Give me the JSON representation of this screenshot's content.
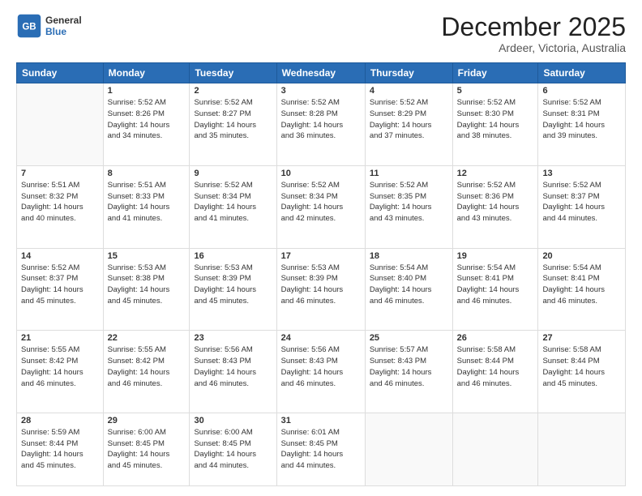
{
  "logo": {
    "general": "General",
    "blue": "Blue"
  },
  "header": {
    "month": "December 2025",
    "location": "Ardeer, Victoria, Australia"
  },
  "weekdays": [
    "Sunday",
    "Monday",
    "Tuesday",
    "Wednesday",
    "Thursday",
    "Friday",
    "Saturday"
  ],
  "weeks": [
    [
      {
        "day": "",
        "sunrise": "",
        "sunset": "",
        "daylight": ""
      },
      {
        "day": "1",
        "sunrise": "Sunrise: 5:52 AM",
        "sunset": "Sunset: 8:26 PM",
        "daylight": "Daylight: 14 hours",
        "minutes": "and 34 minutes."
      },
      {
        "day": "2",
        "sunrise": "Sunrise: 5:52 AM",
        "sunset": "Sunset: 8:27 PM",
        "daylight": "Daylight: 14 hours",
        "minutes": "and 35 minutes."
      },
      {
        "day": "3",
        "sunrise": "Sunrise: 5:52 AM",
        "sunset": "Sunset: 8:28 PM",
        "daylight": "Daylight: 14 hours",
        "minutes": "and 36 minutes."
      },
      {
        "day": "4",
        "sunrise": "Sunrise: 5:52 AM",
        "sunset": "Sunset: 8:29 PM",
        "daylight": "Daylight: 14 hours",
        "minutes": "and 37 minutes."
      },
      {
        "day": "5",
        "sunrise": "Sunrise: 5:52 AM",
        "sunset": "Sunset: 8:30 PM",
        "daylight": "Daylight: 14 hours",
        "minutes": "and 38 minutes."
      },
      {
        "day": "6",
        "sunrise": "Sunrise: 5:52 AM",
        "sunset": "Sunset: 8:31 PM",
        "daylight": "Daylight: 14 hours",
        "minutes": "and 39 minutes."
      }
    ],
    [
      {
        "day": "7",
        "sunrise": "Sunrise: 5:51 AM",
        "sunset": "Sunset: 8:32 PM",
        "daylight": "Daylight: 14 hours",
        "minutes": "and 40 minutes."
      },
      {
        "day": "8",
        "sunrise": "Sunrise: 5:51 AM",
        "sunset": "Sunset: 8:33 PM",
        "daylight": "Daylight: 14 hours",
        "minutes": "and 41 minutes."
      },
      {
        "day": "9",
        "sunrise": "Sunrise: 5:52 AM",
        "sunset": "Sunset: 8:34 PM",
        "daylight": "Daylight: 14 hours",
        "minutes": "and 41 minutes."
      },
      {
        "day": "10",
        "sunrise": "Sunrise: 5:52 AM",
        "sunset": "Sunset: 8:34 PM",
        "daylight": "Daylight: 14 hours",
        "minutes": "and 42 minutes."
      },
      {
        "day": "11",
        "sunrise": "Sunrise: 5:52 AM",
        "sunset": "Sunset: 8:35 PM",
        "daylight": "Daylight: 14 hours",
        "minutes": "and 43 minutes."
      },
      {
        "day": "12",
        "sunrise": "Sunrise: 5:52 AM",
        "sunset": "Sunset: 8:36 PM",
        "daylight": "Daylight: 14 hours",
        "minutes": "and 43 minutes."
      },
      {
        "day": "13",
        "sunrise": "Sunrise: 5:52 AM",
        "sunset": "Sunset: 8:37 PM",
        "daylight": "Daylight: 14 hours",
        "minutes": "and 44 minutes."
      }
    ],
    [
      {
        "day": "14",
        "sunrise": "Sunrise: 5:52 AM",
        "sunset": "Sunset: 8:37 PM",
        "daylight": "Daylight: 14 hours",
        "minutes": "and 45 minutes."
      },
      {
        "day": "15",
        "sunrise": "Sunrise: 5:53 AM",
        "sunset": "Sunset: 8:38 PM",
        "daylight": "Daylight: 14 hours",
        "minutes": "and 45 minutes."
      },
      {
        "day": "16",
        "sunrise": "Sunrise: 5:53 AM",
        "sunset": "Sunset: 8:39 PM",
        "daylight": "Daylight: 14 hours",
        "minutes": "and 45 minutes."
      },
      {
        "day": "17",
        "sunrise": "Sunrise: 5:53 AM",
        "sunset": "Sunset: 8:39 PM",
        "daylight": "Daylight: 14 hours",
        "minutes": "and 46 minutes."
      },
      {
        "day": "18",
        "sunrise": "Sunrise: 5:54 AM",
        "sunset": "Sunset: 8:40 PM",
        "daylight": "Daylight: 14 hours",
        "minutes": "and 46 minutes."
      },
      {
        "day": "19",
        "sunrise": "Sunrise: 5:54 AM",
        "sunset": "Sunset: 8:41 PM",
        "daylight": "Daylight: 14 hours",
        "minutes": "and 46 minutes."
      },
      {
        "day": "20",
        "sunrise": "Sunrise: 5:54 AM",
        "sunset": "Sunset: 8:41 PM",
        "daylight": "Daylight: 14 hours",
        "minutes": "and 46 minutes."
      }
    ],
    [
      {
        "day": "21",
        "sunrise": "Sunrise: 5:55 AM",
        "sunset": "Sunset: 8:42 PM",
        "daylight": "Daylight: 14 hours",
        "minutes": "and 46 minutes."
      },
      {
        "day": "22",
        "sunrise": "Sunrise: 5:55 AM",
        "sunset": "Sunset: 8:42 PM",
        "daylight": "Daylight: 14 hours",
        "minutes": "and 46 minutes."
      },
      {
        "day": "23",
        "sunrise": "Sunrise: 5:56 AM",
        "sunset": "Sunset: 8:43 PM",
        "daylight": "Daylight: 14 hours",
        "minutes": "and 46 minutes."
      },
      {
        "day": "24",
        "sunrise": "Sunrise: 5:56 AM",
        "sunset": "Sunset: 8:43 PM",
        "daylight": "Daylight: 14 hours",
        "minutes": "and 46 minutes."
      },
      {
        "day": "25",
        "sunrise": "Sunrise: 5:57 AM",
        "sunset": "Sunset: 8:43 PM",
        "daylight": "Daylight: 14 hours",
        "minutes": "and 46 minutes."
      },
      {
        "day": "26",
        "sunrise": "Sunrise: 5:58 AM",
        "sunset": "Sunset: 8:44 PM",
        "daylight": "Daylight: 14 hours",
        "minutes": "and 46 minutes."
      },
      {
        "day": "27",
        "sunrise": "Sunrise: 5:58 AM",
        "sunset": "Sunset: 8:44 PM",
        "daylight": "Daylight: 14 hours",
        "minutes": "and 45 minutes."
      }
    ],
    [
      {
        "day": "28",
        "sunrise": "Sunrise: 5:59 AM",
        "sunset": "Sunset: 8:44 PM",
        "daylight": "Daylight: 14 hours",
        "minutes": "and 45 minutes."
      },
      {
        "day": "29",
        "sunrise": "Sunrise: 6:00 AM",
        "sunset": "Sunset: 8:45 PM",
        "daylight": "Daylight: 14 hours",
        "minutes": "and 45 minutes."
      },
      {
        "day": "30",
        "sunrise": "Sunrise: 6:00 AM",
        "sunset": "Sunset: 8:45 PM",
        "daylight": "Daylight: 14 hours",
        "minutes": "and 44 minutes."
      },
      {
        "day": "31",
        "sunrise": "Sunrise: 6:01 AM",
        "sunset": "Sunset: 8:45 PM",
        "daylight": "Daylight: 14 hours",
        "minutes": "and 44 minutes."
      },
      {
        "day": "",
        "sunrise": "",
        "sunset": "",
        "daylight": ""
      },
      {
        "day": "",
        "sunrise": "",
        "sunset": "",
        "daylight": ""
      },
      {
        "day": "",
        "sunrise": "",
        "sunset": "",
        "daylight": ""
      }
    ]
  ]
}
